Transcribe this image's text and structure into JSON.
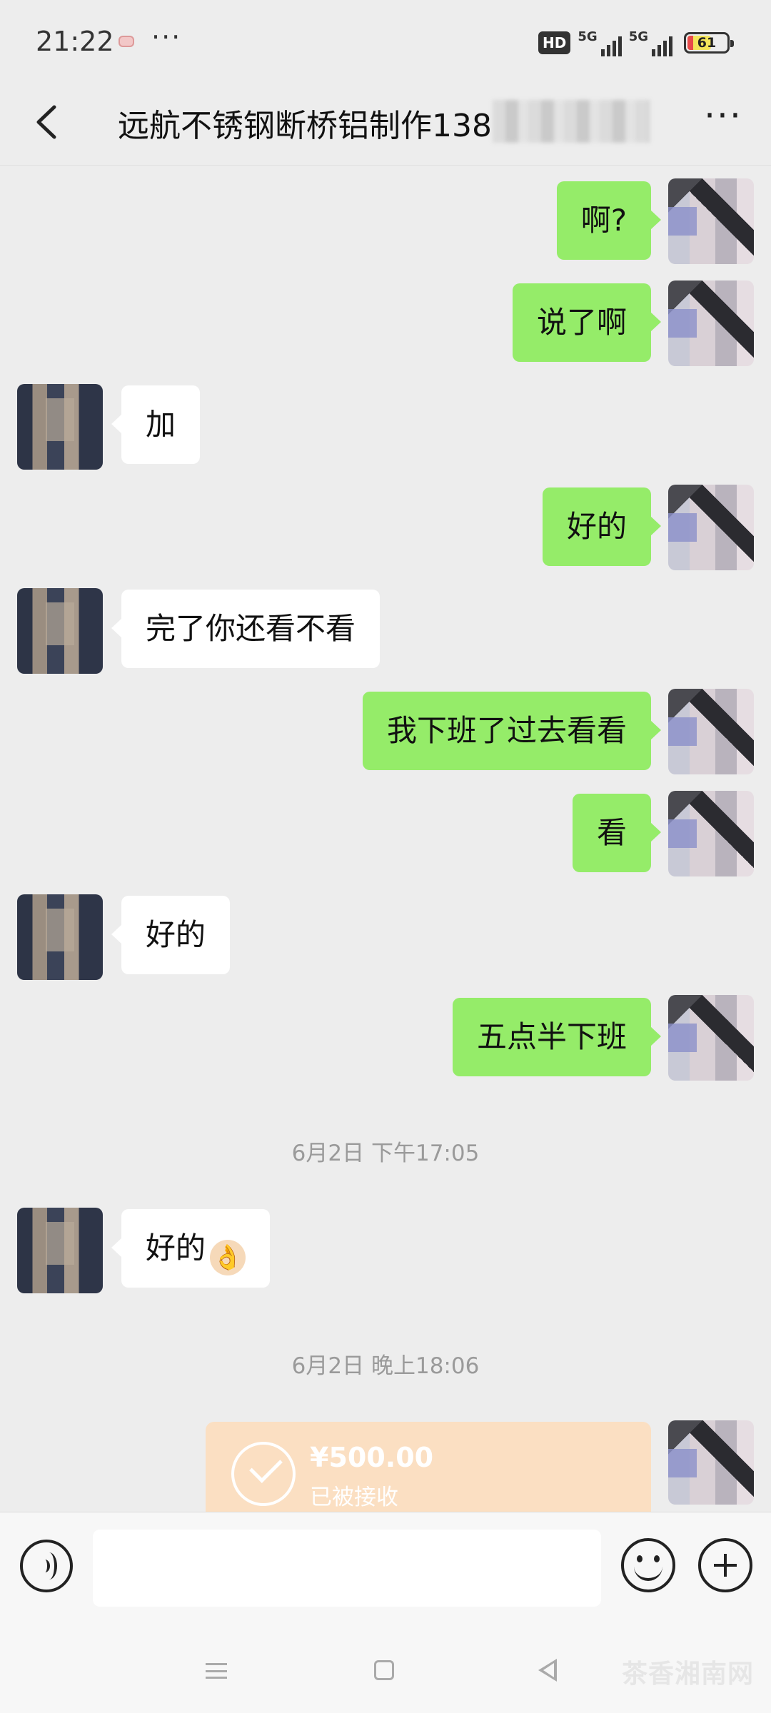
{
  "status_bar": {
    "time": "21:22",
    "more": "···",
    "hd_label": "HD",
    "net1_label": "5G",
    "net2_label": "5G",
    "battery_level": "61"
  },
  "header": {
    "title": "远航不锈钢断桥铝制作138",
    "more_glyph": "···"
  },
  "messages": [
    {
      "sender": "me",
      "text": "啊?"
    },
    {
      "sender": "me",
      "text": "说了啊"
    },
    {
      "sender": "other",
      "text": "加"
    },
    {
      "sender": "me",
      "text": "好的"
    },
    {
      "sender": "other",
      "text": "完了你还看不看"
    },
    {
      "sender": "me",
      "text": "我下班了过去看看"
    },
    {
      "sender": "me",
      "text": "看"
    },
    {
      "sender": "other",
      "text": "好的"
    },
    {
      "sender": "me",
      "text": "五点半下班"
    },
    {
      "sender": "other",
      "text": "好的",
      "emoji": "👌"
    }
  ],
  "timestamps": [
    "6月2日 下午17:05",
    "6月2日 晚上18:06"
  ],
  "transfer": {
    "amount": "¥500.00",
    "status": "已被接收"
  },
  "input": {
    "value": ""
  },
  "watermark": "茶香湘南网",
  "colors": {
    "my_bubble": "#95ec69",
    "their_bubble": "#ffffff",
    "background": "#ededed",
    "transfer_card": "#fbdfc2"
  },
  "icons": {
    "back": "back-arrow-icon",
    "more": "more-icon",
    "voice": "voice-icon",
    "emoji": "emoji-icon",
    "plus": "plus-icon",
    "transfer": "check-circle-icon"
  }
}
